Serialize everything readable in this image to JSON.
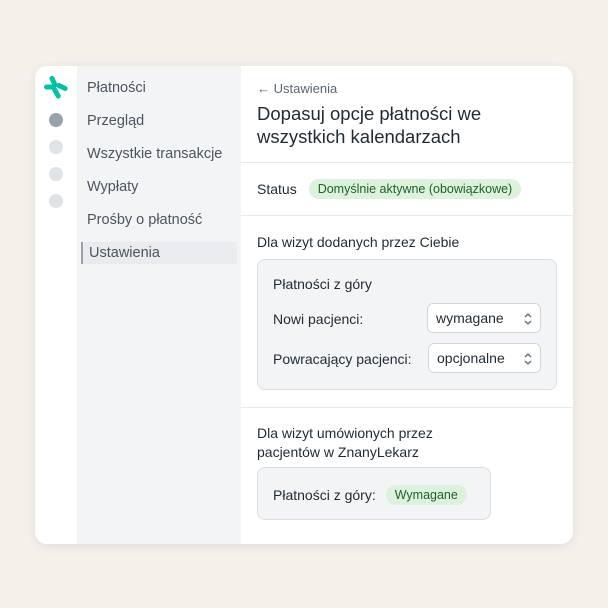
{
  "sidebar": {
    "items": [
      {
        "label": "Płatności"
      },
      {
        "label": "Przegląd"
      },
      {
        "label": "Wszystkie transakcje"
      },
      {
        "label": "Wypłaty"
      },
      {
        "label": "Prośby o płatność"
      },
      {
        "label": "Ustawienia"
      }
    ]
  },
  "main": {
    "back_label": "← Ustawienia",
    "title": "Dopasuj opcje płatności we wszystkich kalendarzach",
    "status": {
      "label": "Status",
      "badge": "Domyślnie aktywne (obowiązkowe)"
    },
    "section1": {
      "title": "Dla wizyt dodanych przez Ciebie",
      "card_title": "Płatności z góry",
      "new_patients_label": "Nowi pacjenci:",
      "new_patients_value": "wymagane",
      "returning_patients_label": "Powracający pacjenci:",
      "returning_patients_value": "opcjonalne"
    },
    "section2": {
      "title": "Dla wizyt umówionych przez pacjentów w ZnanyLekarz",
      "prepay_label": "Płatności z góry:",
      "prepay_badge": "Wymagane"
    }
  },
  "colors": {
    "brand": "#00c3a5",
    "badge_bg": "#dcf2dc",
    "badge_text": "#1f5f2b"
  },
  "icons": {
    "logo": "znanylekarz-logo",
    "select_chevron": "chevron-up-down-icon"
  }
}
